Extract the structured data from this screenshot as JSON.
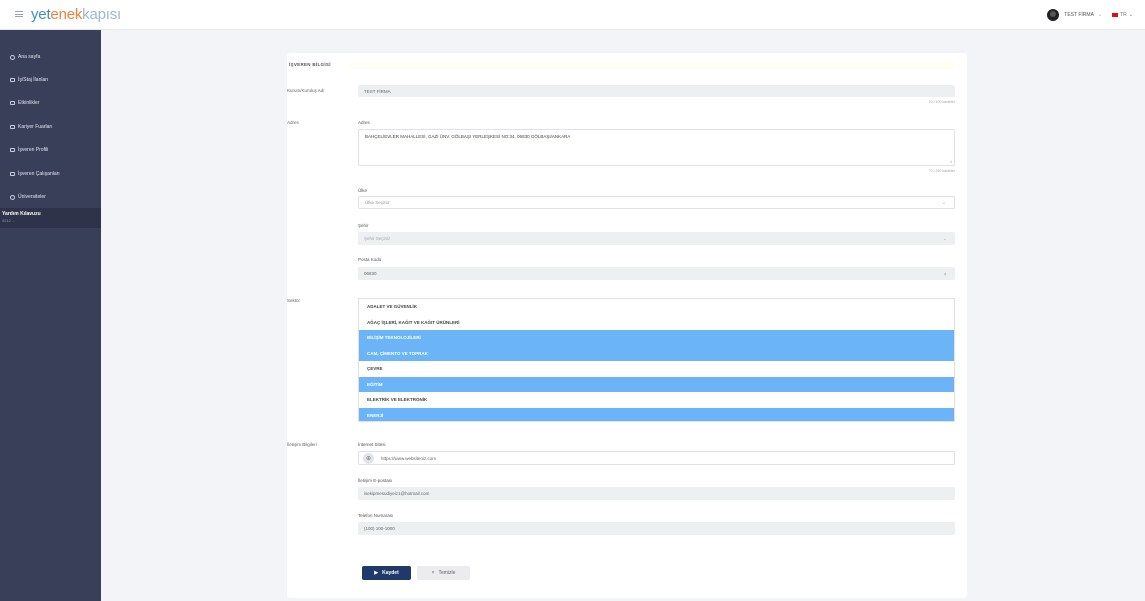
{
  "header": {
    "logo": {
      "part1": "yet",
      "part2": "enek",
      "part3": "kapısı"
    },
    "user_name": "TEST FİRMA",
    "lang": "TR"
  },
  "sidebar": {
    "items": [
      {
        "label": "Ana sayfa",
        "icon": "home-icon"
      },
      {
        "label": "İş/Staj İlanları",
        "icon": "briefcase-icon"
      },
      {
        "label": "Etkinlikler",
        "icon": "calendar-icon"
      },
      {
        "label": "Kariyer Fuarları",
        "icon": "fair-icon"
      },
      {
        "label": "İşveren Profili",
        "icon": "profile-icon"
      },
      {
        "label": "İşveren Çalışanları",
        "icon": "team-icon"
      },
      {
        "label": "Üniversiteler",
        "icon": "university-icon"
      }
    ],
    "help_title": "Yardım Kılavuzu",
    "help_sub": "0212 ..."
  },
  "form": {
    "section_title": "İŞVEREN BİLGİSİ",
    "company_label": "Kurum/Kuruluş Adı",
    "company_value": "TEST FİRMA",
    "company_helper": "10 / 100 karakter",
    "address_row_label": "Adres",
    "address_label": "Adres",
    "address_value": "BAHÇELİEVLER MAHALLESİ, GAZİ ÜNV. GÖLBAŞI YERLEŞKESİ NO:34, 06830 GÖLBAŞI/ANKARA",
    "address_helper": "70 / 250 karakter",
    "country_label": "Ülke",
    "country_placeholder": "Ülke Seçiniz",
    "city_label": "Şehir",
    "city_placeholder": "Şehir Seçiniz",
    "postal_label": "Posta Kodu",
    "postal_value": "06830",
    "sector_label": "Sektör",
    "sectors": [
      {
        "label": "ADALET VE GÜVENLİK",
        "selected": false
      },
      {
        "label": "AĞAÇ İŞLERİ, KAĞIT VE KAĞIT ÜRÜNLERİ",
        "selected": false
      },
      {
        "label": "BİLİŞİM TEKNOLOJİLERİ",
        "selected": true
      },
      {
        "label": "CAM, ÇİMENTO VE TOPRAK",
        "selected": true
      },
      {
        "label": "ÇEVRE",
        "selected": false
      },
      {
        "label": "EĞİTİM",
        "selected": true
      },
      {
        "label": "ELEKTRİK VE ELEKTRONİK",
        "selected": false
      },
      {
        "label": "ENERJİ",
        "selected": true
      }
    ],
    "contact_row_label": "İletişim Bilgileri",
    "website_label": "İnternet Sitesi",
    "website_value": "https://www.websiteniz.com",
    "email_label": "İletişim E-postası",
    "email_value": "isekipmesudiyeiz1@hotmail.com",
    "phone_label": "Telefon Numarası",
    "phone_value": "(100) 100-1000",
    "save_label": "Kaydet",
    "clear_label": "Temizle"
  }
}
